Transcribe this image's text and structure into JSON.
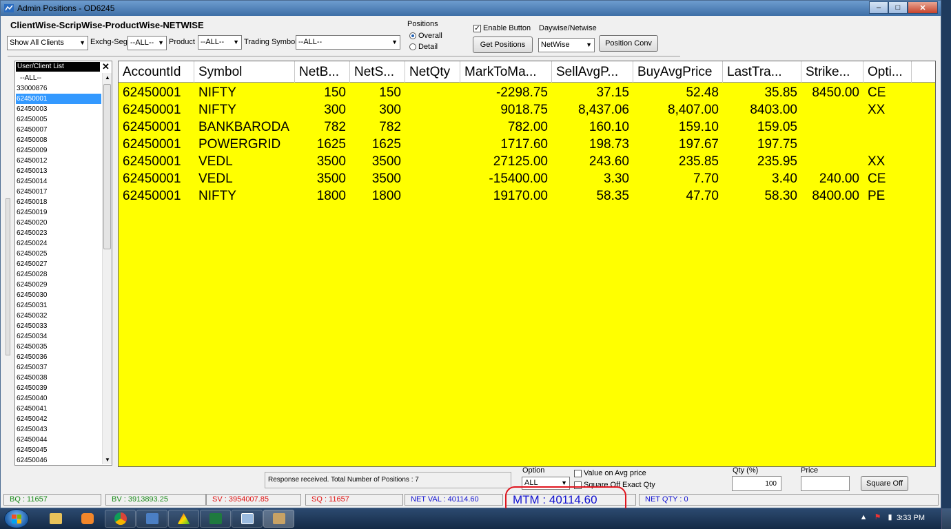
{
  "window": {
    "title": "Admin Positions - OD6245"
  },
  "header": {
    "title": "ClientWise-ScripWise-ProductWise-NETWISE",
    "client_filter": "Show All Clients",
    "exchg_seg_label": "Exchg-Seg",
    "exchg_seg_value": "--ALL--",
    "product_label": "Product",
    "product_value": "--ALL--",
    "trading_symbol_label": "Trading Symbol",
    "trading_symbol_value": "--ALL--",
    "positions_label": "Positions",
    "positions_overall": "Overall",
    "positions_detail": "Detail",
    "enable_button": "Enable Button",
    "get_positions": "Get Positions",
    "daywise_label": "Daywise/Netwise",
    "daywise_value": "NetWise",
    "position_conv": "Position Conv"
  },
  "client_list": {
    "header": "User/Client List",
    "items": [
      "--ALL--",
      "33000876",
      "62450001",
      "62450003",
      "62450005",
      "62450007",
      "62450008",
      "62450009",
      "62450012",
      "62450013",
      "62450014",
      "62450017",
      "62450018",
      "62450019",
      "62450020",
      "62450023",
      "62450024",
      "62450025",
      "62450027",
      "62450028",
      "62450029",
      "62450030",
      "62450031",
      "62450032",
      "62450033",
      "62450034",
      "62450035",
      "62450036",
      "62450037",
      "62450038",
      "62450039",
      "62450040",
      "62450041",
      "62450042",
      "62450043",
      "62450044",
      "62450045",
      "62450046"
    ],
    "selected": "62450001"
  },
  "grid": {
    "columns": [
      "AccountId",
      "Symbol",
      "NetB...",
      "NetS...",
      "NetQty",
      "MarkToMa...",
      "SellAvgP...",
      "BuyAvgPrice",
      "LastTra...",
      "Strike...",
      "Opti..."
    ],
    "rows": [
      [
        "62450001",
        "NIFTY",
        "150",
        "150",
        "",
        "-2298.75",
        "37.15",
        "52.48",
        "35.85",
        "8450.00",
        "CE"
      ],
      [
        "62450001",
        "NIFTY",
        "300",
        "300",
        "",
        "9018.75",
        "8,437.06",
        "8,407.00",
        "8403.00",
        "",
        "XX"
      ],
      [
        "62450001",
        "BANKBARODA",
        "782",
        "782",
        "",
        "782.00",
        "160.10",
        "159.10",
        "159.05",
        "",
        ""
      ],
      [
        "62450001",
        "POWERGRID",
        "1625",
        "1625",
        "",
        "1717.60",
        "198.73",
        "197.67",
        "197.75",
        "",
        ""
      ],
      [
        "62450001",
        "VEDL",
        "3500",
        "3500",
        "",
        "27125.00",
        "243.60",
        "235.85",
        "235.95",
        "",
        "XX"
      ],
      [
        "62450001",
        "VEDL",
        "3500",
        "3500",
        "",
        "-15400.00",
        "3.30",
        "7.70",
        "3.40",
        "240.00",
        "CE"
      ],
      [
        "62450001",
        "NIFTY",
        "1800",
        "1800",
        "",
        "19170.00",
        "58.35",
        "47.70",
        "58.30",
        "8400.00",
        "PE"
      ]
    ]
  },
  "bottom": {
    "status_message": "Response received. Total Number of Positions : 7",
    "option_label": "Option",
    "option_value": "ALL",
    "value_on_avg": "Value on Avg  price",
    "square_off_exact": "Square Off Exact Qty",
    "qty_label": "Qty (%)",
    "qty_value": "100",
    "price_label": "Price",
    "price_value": "",
    "square_off_button": "Square Off"
  },
  "status_strip": {
    "bq": "BQ : 11657",
    "bv": "BV : 3913893.25",
    "sv": "SV : 3954007.85",
    "sq": "SQ : 11657",
    "net_val": "NET VAL : 40114.60",
    "mtm": "MTM : 40114.60",
    "net_qty": "NET QTY : 0"
  },
  "taskbar": {
    "clock": "3:33 PM"
  },
  "colors": {
    "grid_bg": "#ffff00",
    "selected": "#3399ff",
    "buy": "#1a8a1a",
    "sell": "#e01010",
    "blue": "#1010d0"
  }
}
